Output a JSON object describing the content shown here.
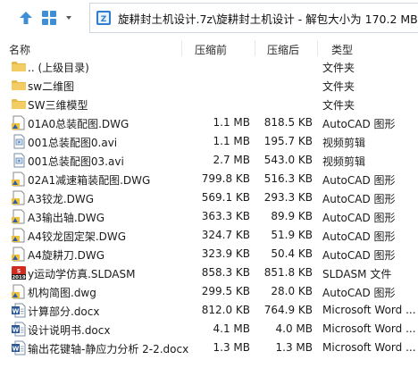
{
  "toolbar": {
    "up_icon": "arrow-up-icon",
    "view_icon": "view-grid-icon",
    "address": "旋耕封土机设计.7z\\旋耕封土机设计 - 解包大小为 170.2 MB"
  },
  "columns": {
    "name": "名称",
    "compressed": "压缩前",
    "original": "压缩后",
    "type": "类型"
  },
  "files": [
    {
      "icon": "folder-up",
      "name": ".. (上级目录)",
      "compressed": "",
      "original": "",
      "type": "文件夹"
    },
    {
      "icon": "folder",
      "name": "sw二维图",
      "compressed": "",
      "original": "",
      "type": "文件夹"
    },
    {
      "icon": "folder",
      "name": "SW三维模型",
      "compressed": "",
      "original": "",
      "type": "文件夹"
    },
    {
      "icon": "dwg",
      "name": "01A0总装配图.DWG",
      "compressed": "1.1 MB",
      "original": "818.5 KB",
      "type": "AutoCAD 图形"
    },
    {
      "icon": "video",
      "name": "001总装配图0.avi",
      "compressed": "1.1 MB",
      "original": "195.7 KB",
      "type": "视频剪辑"
    },
    {
      "icon": "video",
      "name": "001总装配图03.avi",
      "compressed": "2.7 MB",
      "original": "543.0 KB",
      "type": "视频剪辑"
    },
    {
      "icon": "dwg",
      "name": "02A1减速箱装配图.DWG",
      "compressed": "799.8 KB",
      "original": "516.3 KB",
      "type": "AutoCAD 图形"
    },
    {
      "icon": "dwg",
      "name": "A3铰龙.DWG",
      "compressed": "569.1 KB",
      "original": "293.3 KB",
      "type": "AutoCAD 图形"
    },
    {
      "icon": "dwg",
      "name": "A3输出轴.DWG",
      "compressed": "363.3 KB",
      "original": "89.9 KB",
      "type": "AutoCAD 图形"
    },
    {
      "icon": "dwg",
      "name": "A4铰龙固定架.DWG",
      "compressed": "324.7 KB",
      "original": "51.9 KB",
      "type": "AutoCAD 图形"
    },
    {
      "icon": "dwg",
      "name": "A4旋耕刀.DWG",
      "compressed": "323.9 KB",
      "original": "50.4 KB",
      "type": "AutoCAD 图形"
    },
    {
      "icon": "sw",
      "name": "y运动学仿真.SLDASM",
      "compressed": "858.3 KB",
      "original": "851.8 KB",
      "type": "SLDASM 文件",
      "icon_text": "2019"
    },
    {
      "icon": "dwg",
      "name": "机构简图.dwg",
      "compressed": "299.5 KB",
      "original": "28.0 KB",
      "type": "AutoCAD 图形"
    },
    {
      "icon": "word",
      "name": "计算部分.docx",
      "compressed": "812.0 KB",
      "original": "764.9 KB",
      "type": "Microsoft Word ..."
    },
    {
      "icon": "word",
      "name": "设计说明书.docx",
      "compressed": "4.1 MB",
      "original": "4.0 MB",
      "type": "Microsoft Word ..."
    },
    {
      "icon": "word",
      "name": "输出花键轴-静应力分析 2-2.docx",
      "compressed": "1.3 MB",
      "original": "1.3 MB",
      "type": "Microsoft Word ..."
    }
  ]
}
